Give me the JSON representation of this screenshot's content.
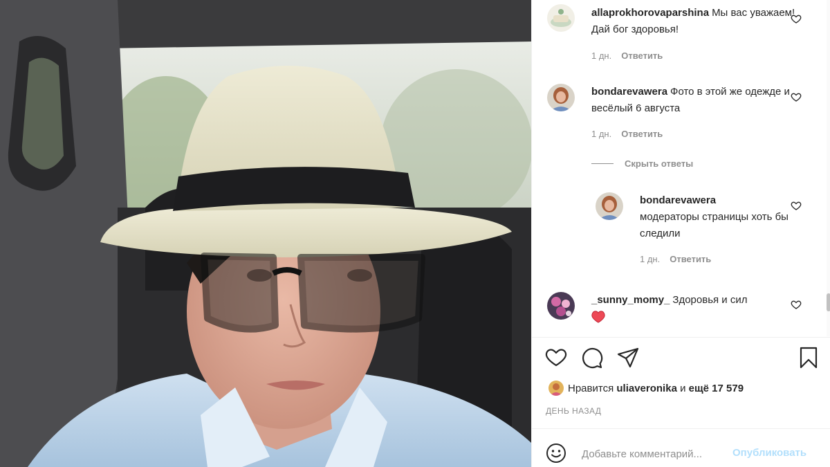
{
  "comments": [
    {
      "username": "allaprokhorovaparshina",
      "text": "Мы вас уважаем! Дай бог здоровья!",
      "time": "1 дн.",
      "reply_label": "Ответить",
      "avatar_icon": "cake-avatar"
    },
    {
      "username": "bondarevawera",
      "text": "Фото в этой же одежде и весёлый 6 августа",
      "time": "1 дн.",
      "reply_label": "Ответить",
      "avatar_icon": "woman-avatar",
      "hide_replies_label": "Скрыть ответы",
      "replies": [
        {
          "username": "bondarevawera",
          "text": "модераторы страницы хоть бы следили",
          "time": "1 дн.",
          "reply_label": "Ответить",
          "avatar_icon": "woman-avatar"
        }
      ]
    },
    {
      "username": "_sunny_momy_",
      "text": "Здоровья и сил",
      "emoji": "red-heart",
      "avatar_icon": "flowers-avatar"
    }
  ],
  "actions": {
    "like_icon": "heart-outline-icon",
    "comment_icon": "comment-bubble-icon",
    "share_icon": "paper-plane-icon",
    "save_icon": "bookmark-icon"
  },
  "likes": {
    "prefix": "Нравится",
    "user": "uliaveronika",
    "middle": "и",
    "count_text": "ещё 17 579"
  },
  "timestamp": "ДЕНЬ НАЗАД",
  "add_comment": {
    "placeholder": "Добавьте комментарий...",
    "publish_label": "Опубликовать",
    "emoji_icon": "smiley-icon"
  },
  "colors": {
    "text": "#262626",
    "muted": "#8e8e8e",
    "publish_disabled": "#b2dffc",
    "heart_red": "#ed4956"
  }
}
